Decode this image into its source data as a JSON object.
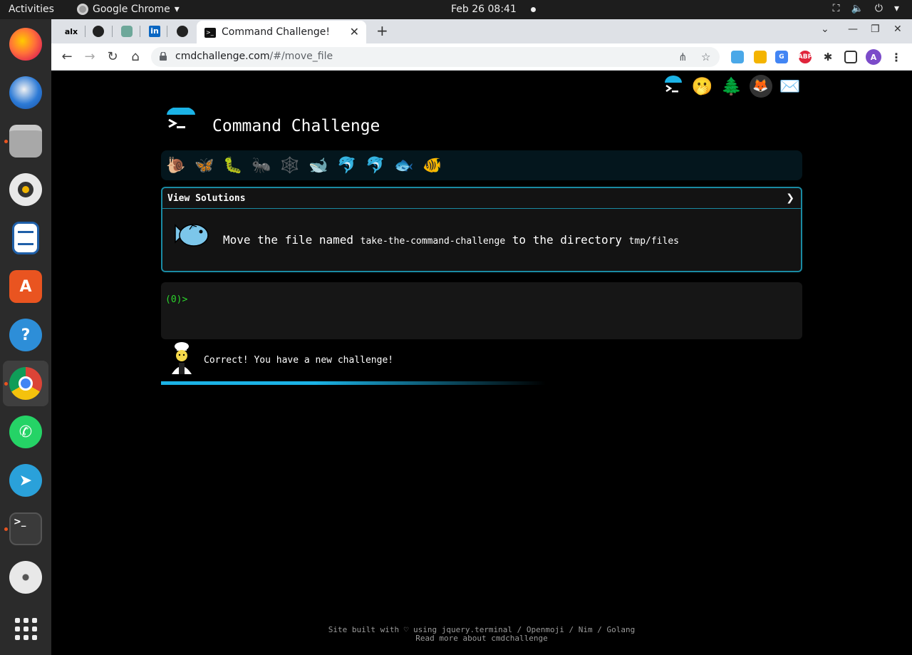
{
  "system": {
    "activities": "Activities",
    "app_name": "Google Chrome",
    "clock": "Feb 26  08:41"
  },
  "browser": {
    "pinned_tabs": [
      {
        "label": "alx",
        "icon": "alx-icon"
      },
      {
        "label": "",
        "icon": "github-icon"
      },
      {
        "label": "",
        "icon": "chatgpt-icon"
      },
      {
        "label": "in",
        "icon": "linkedin-icon"
      },
      {
        "label": "",
        "icon": "github-icon"
      }
    ],
    "active_tab": {
      "title": "Command Challenge!"
    },
    "url_host": "cmdchallenge.com",
    "url_path": "/#/move_file"
  },
  "page": {
    "title": "Command Challenge",
    "solutions_label": "View Solutions",
    "challenge": {
      "text_1": "Move the file named ",
      "code_1": "take-the-command-challenge",
      "text_2": " to the directory ",
      "code_2": "tmp/files"
    },
    "prompt": "(0)>",
    "status_message": "Correct! You have a new challenge!",
    "footer_line1": "Site built with ♡ using jquery.terminal / Openmoji / Nim / Golang",
    "footer_line2": "Read more about cmdchallenge",
    "level_icons": [
      "snail-icon",
      "butterfly-icon",
      "caterpillar-icon",
      "ant-icon",
      "spider-web-icon",
      "whale-icon",
      "dolphin-blue-icon",
      "dolphin-gray-icon",
      "fish-icon",
      "tropical-fish-icon"
    ]
  }
}
